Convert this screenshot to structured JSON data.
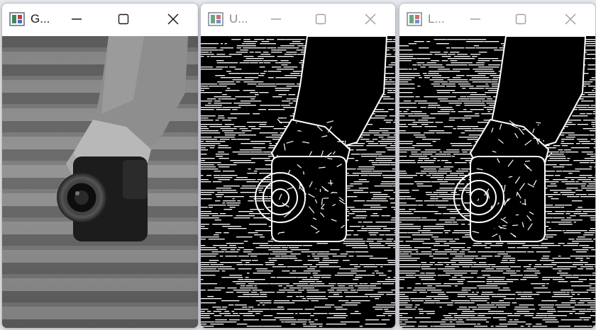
{
  "windows": [
    {
      "title": "G...",
      "state": "active",
      "content": "grayscale-photo"
    },
    {
      "title": "U...",
      "state": "inactive",
      "content": "edge-map-1"
    },
    {
      "title": "L...",
      "state": "inactive",
      "content": "edge-map-2"
    }
  ],
  "icons": {
    "app": "image-window-icon",
    "minimize": "minimize-icon",
    "maximize": "maximize-icon",
    "close": "close-icon"
  },
  "colors": {
    "active_glyph": "#1a1a1a",
    "inactive_glyph": "#9a9a9a",
    "titlebar": "#ffffff"
  }
}
